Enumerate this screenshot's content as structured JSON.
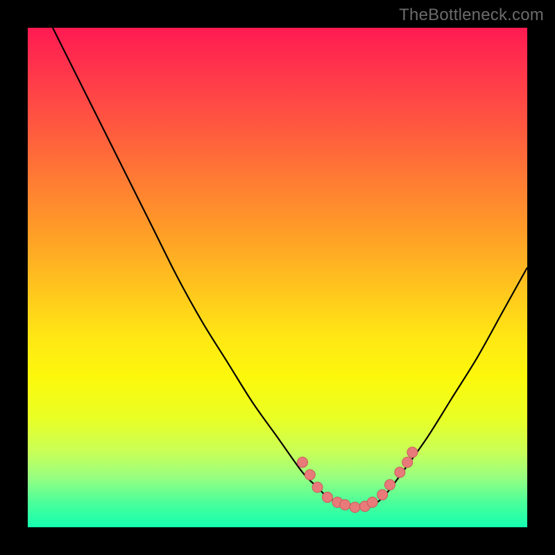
{
  "watermark": "TheBottleneck.com",
  "colors": {
    "page_bg": "#000000",
    "curve": "#000000",
    "marker_fill": "#e87a7a",
    "marker_stroke": "#c85a5a",
    "gradient_top": "#ff1a52",
    "gradient_bottom": "#14ffb0"
  },
  "chart_data": {
    "type": "line",
    "title": "",
    "xlabel": "",
    "ylabel": "",
    "xlim": [
      0,
      100
    ],
    "ylim": [
      0,
      100
    ],
    "grid": false,
    "legend": false,
    "series": [
      {
        "name": "curve",
        "x": [
          5,
          10,
          15,
          20,
          25,
          30,
          35,
          40,
          45,
          50,
          55,
          58,
          60,
          62,
          64,
          66,
          68,
          70,
          72,
          75,
          80,
          85,
          90,
          95,
          100
        ],
        "y": [
          100,
          90,
          80,
          70,
          60,
          50,
          41,
          33,
          25,
          18,
          11,
          8,
          6,
          5,
          4,
          4,
          4,
          5,
          7,
          11,
          18,
          26,
          34,
          43,
          52
        ]
      }
    ],
    "markers": [
      {
        "x": 55.0,
        "y": 13.0
      },
      {
        "x": 56.5,
        "y": 10.5
      },
      {
        "x": 58.0,
        "y": 8.0
      },
      {
        "x": 60.0,
        "y": 6.0
      },
      {
        "x": 62.0,
        "y": 5.0
      },
      {
        "x": 63.5,
        "y": 4.5
      },
      {
        "x": 65.5,
        "y": 4.0
      },
      {
        "x": 67.5,
        "y": 4.2
      },
      {
        "x": 69.0,
        "y": 5.0
      },
      {
        "x": 71.0,
        "y": 6.5
      },
      {
        "x": 72.5,
        "y": 8.5
      },
      {
        "x": 74.5,
        "y": 11.0
      },
      {
        "x": 76.0,
        "y": 13.0
      },
      {
        "x": 77.0,
        "y": 15.0
      }
    ]
  }
}
